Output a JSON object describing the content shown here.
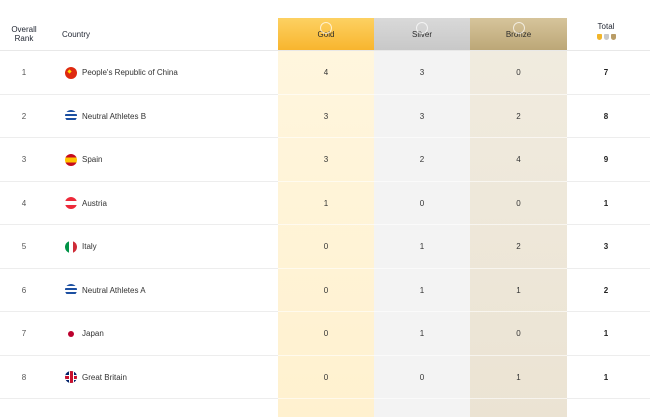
{
  "header": {
    "rank_label": "Overall\nRank",
    "country_label": "Country",
    "gold_label": "Gold",
    "silver_label": "Silver",
    "bronze_label": "Bronze",
    "total_label": "Total"
  },
  "rows": [
    {
      "rank": "1",
      "country": "People's Republic of China",
      "flag_icon": "china-flag-icon",
      "gold": "4",
      "silver": "3",
      "bronze": "0",
      "total": "7"
    },
    {
      "rank": "2",
      "country": "Neutral Athletes B",
      "flag_icon": "neutral-athletes-flag-icon",
      "gold": "3",
      "silver": "3",
      "bronze": "2",
      "total": "8"
    },
    {
      "rank": "3",
      "country": "Spain",
      "flag_icon": "spain-flag-icon",
      "gold": "3",
      "silver": "2",
      "bronze": "4",
      "total": "9"
    },
    {
      "rank": "4",
      "country": "Austria",
      "flag_icon": "austria-flag-icon",
      "gold": "1",
      "silver": "0",
      "bronze": "0",
      "total": "1"
    },
    {
      "rank": "5",
      "country": "Italy",
      "flag_icon": "italy-flag-icon",
      "gold": "0",
      "silver": "1",
      "bronze": "2",
      "total": "3"
    },
    {
      "rank": "6",
      "country": "Neutral Athletes A",
      "flag_icon": "neutral-athletes-flag-icon",
      "gold": "0",
      "silver": "1",
      "bronze": "1",
      "total": "2"
    },
    {
      "rank": "7",
      "country": "Japan",
      "flag_icon": "japan-flag-icon",
      "gold": "0",
      "silver": "1",
      "bronze": "0",
      "total": "1"
    },
    {
      "rank": "8",
      "country": "Great Britain",
      "flag_icon": "great-britain-flag-icon",
      "gold": "0",
      "silver": "0",
      "bronze": "1",
      "total": "1"
    }
  ],
  "colors": {
    "gold": "#f8b52e",
    "silver": "#c8c8c8",
    "bronze": "#bca777"
  }
}
